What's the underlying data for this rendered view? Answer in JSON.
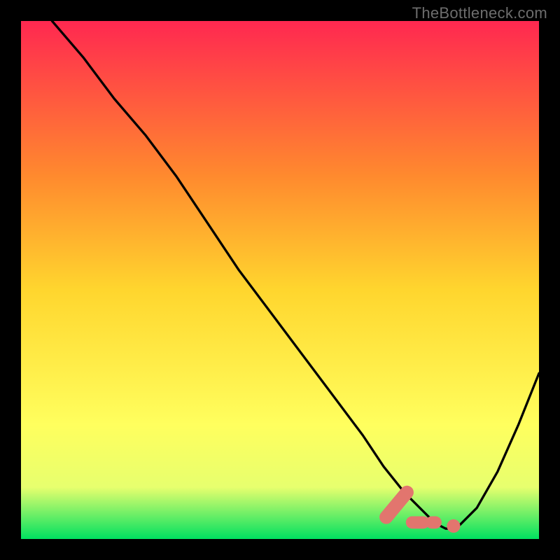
{
  "watermark": "TheBottleneck.com",
  "colors": {
    "frame": "#000000",
    "grad_top": "#ff2850",
    "grad_mid1": "#ff8a2e",
    "grad_mid2": "#ffd62e",
    "grad_mid3": "#ffff5e",
    "grad_mid4": "#e7ff6e",
    "grad_bottom": "#00e060",
    "curve": "#000000",
    "marker_fill": "#e2756e",
    "marker_stroke": "#e2756e"
  },
  "chart_data": {
    "type": "line",
    "title": "",
    "xlabel": "",
    "ylabel": "",
    "xlim": [
      0,
      100
    ],
    "ylim": [
      0,
      100
    ],
    "series": [
      {
        "name": "bottleneck-curve",
        "x": [
          6,
          12,
          18,
          24,
          30,
          36,
          42,
          48,
          54,
          60,
          66,
          70,
          74,
          78,
          80,
          82,
          84,
          88,
          92,
          96,
          100
        ],
        "y": [
          100,
          93,
          85,
          78,
          70,
          61,
          52,
          44,
          36,
          28,
          20,
          14,
          9,
          5,
          3,
          2,
          2,
          6,
          13,
          22,
          32
        ]
      }
    ],
    "markers": {
      "name": "highlighted-range",
      "bar": {
        "x0": 70.5,
        "x1": 74.5,
        "y0": 4.2,
        "y1": 9.0
      },
      "dash1": {
        "x0": 75.5,
        "x1": 80.0,
        "y": 3.2
      },
      "dot": {
        "x": 83.5,
        "y": 2.5,
        "r": 1.3
      }
    }
  }
}
